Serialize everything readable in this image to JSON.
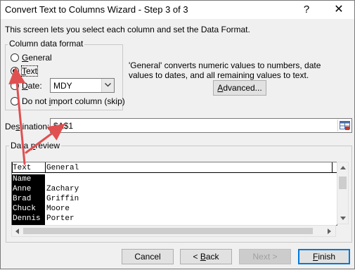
{
  "window": {
    "title": "Convert Text to Columns Wizard - Step 3 of 3",
    "help_glyph": "?",
    "close_glyph": "✕"
  },
  "intro": "This screen lets you select each column and set the Data Format.",
  "column_format": {
    "legend": "Column data format",
    "options": [
      {
        "key": "G",
        "rest": "eneral",
        "checked": false
      },
      {
        "key": "T",
        "rest": "ext",
        "checked": true
      },
      {
        "key": "D",
        "rest": "ate:",
        "checked": false
      },
      {
        "pre": "Do not ",
        "key": "i",
        "rest": "mport column (skip)",
        "checked": false
      }
    ],
    "date_format": "MDY"
  },
  "description": "'General' converts numeric values to numbers, date values to dates, and all remaining values to text.",
  "advanced_button": {
    "key": "A",
    "rest": "dvanced..."
  },
  "destination": {
    "label_pre": "De",
    "label_key": "s",
    "label_post": "tination:",
    "value": "$A$1"
  },
  "preview": {
    "legend_pre": "Data ",
    "legend_key": "p",
    "legend_post": "review",
    "headers": [
      "Text",
      "General"
    ],
    "rows": [
      [
        "Name",
        ""
      ],
      [
        "Anne",
        "Zachary"
      ],
      [
        "Brad",
        "Griffin"
      ],
      [
        "Chuck",
        "Moore"
      ],
      [
        "Dennis",
        "Porter"
      ]
    ]
  },
  "buttons": {
    "cancel": "Cancel",
    "back": "< Back",
    "back_key": "B",
    "next": "Next >",
    "finish": "Finish",
    "finish_key": "F"
  },
  "colors": {
    "annotation_arrow": "#e05050",
    "selection": "#000000",
    "default_button_border": "#0078d7"
  },
  "icons": {
    "dropdown": "chevron-down-icon",
    "range_selector": "range-selector-icon",
    "help": "help-icon",
    "close": "close-icon"
  }
}
